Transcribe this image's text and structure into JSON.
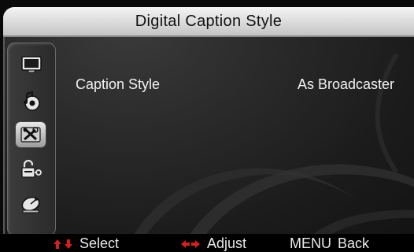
{
  "window": {
    "title": "Digital Caption Style"
  },
  "sidebar": {
    "items": [
      {
        "icon": "tv-screen-icon",
        "selected": false
      },
      {
        "icon": "audio-icon",
        "selected": false
      },
      {
        "icon": "tools-icon",
        "selected": true
      },
      {
        "icon": "lock-icon",
        "selected": false
      },
      {
        "icon": "satellite-dish-icon",
        "selected": false
      }
    ]
  },
  "settings": {
    "rows": [
      {
        "label": "Caption Style",
        "value": "As Broadcaster"
      }
    ]
  },
  "footer": {
    "select_label": "Select",
    "adjust_label": "Adjust",
    "menu_key": "MENU",
    "back_label": "Back"
  },
  "colors": {
    "title_bar": "#d8d8d8",
    "background": "#1b1b1b",
    "text": "#f2f2f2",
    "arrow_red": "#d81e1e"
  }
}
